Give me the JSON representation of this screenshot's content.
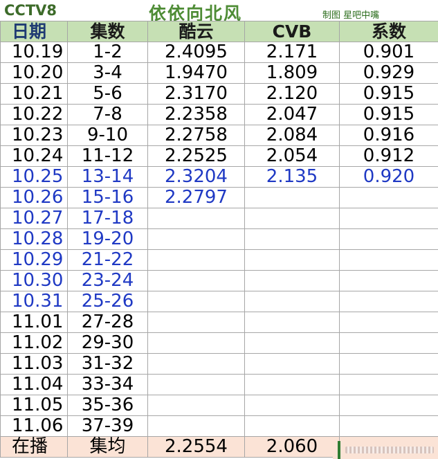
{
  "header": {
    "channel": "CCTV8",
    "title": "依依向北风",
    "credit": "制图 星吧中嘴"
  },
  "columns": [
    "日期",
    "集数",
    "酷云",
    "CVB",
    "系数"
  ],
  "rows": [
    {
      "date": "10.19",
      "episodes": "1-2",
      "kuyun": "2.4095",
      "cvb": "2.171",
      "ratio": "0.901",
      "style": "black"
    },
    {
      "date": "10.20",
      "episodes": "3-4",
      "kuyun": "1.9470",
      "cvb": "1.809",
      "ratio": "0.929",
      "style": "black"
    },
    {
      "date": "10.21",
      "episodes": "5-6",
      "kuyun": "2.3170",
      "cvb": "2.120",
      "ratio": "0.915",
      "style": "black"
    },
    {
      "date": "10.22",
      "episodes": "7-8",
      "kuyun": "2.2358",
      "cvb": "2.047",
      "ratio": "0.915",
      "style": "black"
    },
    {
      "date": "10.23",
      "episodes": "9-10",
      "kuyun": "2.2758",
      "cvb": "2.084",
      "ratio": "0.916",
      "style": "black"
    },
    {
      "date": "10.24",
      "episodes": "11-12",
      "kuyun": "2.2525",
      "cvb": "2.054",
      "ratio": "0.912",
      "style": "black"
    },
    {
      "date": "10.25",
      "episodes": "13-14",
      "kuyun": "2.3204",
      "cvb": "2.135",
      "ratio": "0.920",
      "style": "blue"
    },
    {
      "date": "10.26",
      "episodes": "15-16",
      "kuyun": "2.2797",
      "cvb": "",
      "ratio": "",
      "style": "blue"
    },
    {
      "date": "10.27",
      "episodes": "17-18",
      "kuyun": "",
      "cvb": "",
      "ratio": "",
      "style": "blue"
    },
    {
      "date": "10.28",
      "episodes": "19-20",
      "kuyun": "",
      "cvb": "",
      "ratio": "",
      "style": "blue"
    },
    {
      "date": "10.29",
      "episodes": "21-22",
      "kuyun": "",
      "cvb": "",
      "ratio": "",
      "style": "blue"
    },
    {
      "date": "10.30",
      "episodes": "23-24",
      "kuyun": "",
      "cvb": "",
      "ratio": "",
      "style": "blue"
    },
    {
      "date": "10.31",
      "episodes": "25-26",
      "kuyun": "",
      "cvb": "",
      "ratio": "",
      "style": "blue"
    },
    {
      "date": "11.01",
      "episodes": "27-28",
      "kuyun": "",
      "cvb": "",
      "ratio": "",
      "style": "black"
    },
    {
      "date": "11.02",
      "episodes": "29-30",
      "kuyun": "",
      "cvb": "",
      "ratio": "",
      "style": "black"
    },
    {
      "date": "11.03",
      "episodes": "31-32",
      "kuyun": "",
      "cvb": "",
      "ratio": "",
      "style": "black"
    },
    {
      "date": "11.04",
      "episodes": "33-34",
      "kuyun": "",
      "cvb": "",
      "ratio": "",
      "style": "black"
    },
    {
      "date": "11.05",
      "episodes": "35-36",
      "kuyun": "",
      "cvb": "",
      "ratio": "",
      "style": "black"
    },
    {
      "date": "11.06",
      "episodes": "37-39",
      "kuyun": "",
      "cvb": "",
      "ratio": "",
      "style": "black"
    }
  ],
  "total": {
    "label": "在播",
    "avg_label": "集均",
    "kuyun": "2.2554",
    "cvb": "2.060",
    "ratio": ""
  },
  "colors": {
    "header_bg": "#c6e0b4",
    "total_bg": "#fbe3d6",
    "blue_text": "#1f39c4",
    "title_green": "#4e8c35"
  }
}
